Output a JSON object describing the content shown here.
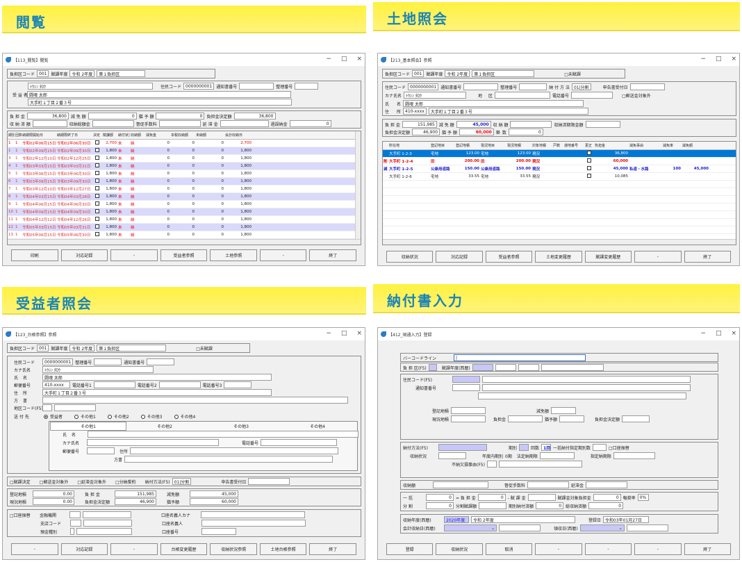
{
  "p1": {
    "banner": "閲覧",
    "title": "【113_閲覧】閲覧",
    "h1": [
      "負担区コード",
      "001",
      "賦課年度",
      "令和 2年度",
      "第１負担区"
    ],
    "jc": "住民コード",
    "jcv": "0000000001",
    "tsu": "通知書番号",
    "sei": "整理番号",
    "kana": "ﾄｳｼﾝ ﾀﾛｳ",
    "jusha": "受 益 者",
    "name": "闘魂 太郎",
    "addr": "大手町１丁目２番３号",
    "r3": [
      "負 担 金",
      "36,800",
      "減 免 額",
      "0",
      "猶 予 額",
      "0",
      "負担金決定額",
      "36,800"
    ],
    "r4": [
      "収 納 済 額",
      "収納総額金",
      "督促手数料",
      "延 滞 金",
      "過誤納金",
      "0"
    ],
    "cols": [
      "期別",
      "回数",
      "納期限開始日",
      "納期限終了日",
      "決定",
      "賦課額",
      "納付状況",
      "収納額",
      "減免金",
      "本税収納額",
      "未納額",
      "会計収納日"
    ],
    "rows": [
      [
        "1",
        "1",
        "令和02年06月15日",
        "令和02年06月30日",
        "2,700",
        "未",
        "納",
        "0",
        "0",
        "0",
        "2,700"
      ],
      [
        "1",
        "1",
        "令和02年09月15日",
        "令和02年09月30日",
        "1,800",
        "未",
        "納",
        "0",
        "0",
        "0",
        "1,800"
      ],
      [
        "3",
        "1",
        "令和02年12月10日",
        "令和02年12月25日",
        "1,800",
        "未",
        "納",
        "0",
        "0",
        "0",
        "1,800"
      ],
      [
        "4",
        "1",
        "令和03年03月15日",
        "令和03年03月31日",
        "1,800",
        "未",
        "納",
        "0",
        "0",
        "0",
        "1,800"
      ],
      [
        "5",
        "1",
        "令和03年06月15日",
        "令和03年06月30日",
        "1,800",
        "未",
        "納",
        "0",
        "0",
        "0",
        "1,800"
      ],
      [
        "6",
        "1",
        "令和03年09月15日",
        "令和03年09月30日",
        "1,800",
        "未",
        "納",
        "0",
        "0",
        "0",
        "1,800"
      ],
      [
        "7",
        "1",
        "令和03年12月10日",
        "令和03年12月27日",
        "1,800",
        "未",
        "納",
        "0",
        "0",
        "0",
        "1,800"
      ],
      [
        "8",
        "1",
        "令和04年03月15日",
        "令和04年03月28日",
        "1,800",
        "未",
        "納",
        "0",
        "0",
        "0",
        "1,800"
      ],
      [
        "9",
        "1",
        "令和04年06月15日",
        "令和04年06月30日",
        "1,800",
        "未",
        "納",
        "0",
        "0",
        "0",
        "1,800"
      ],
      [
        "10",
        "1",
        "令和04年09月15日",
        "令和04年09月30日",
        "1,800",
        "未",
        "納",
        "0",
        "0",
        "0",
        "1,800"
      ],
      [
        "11",
        "1",
        "令和04年12月12日",
        "令和04年12月26日",
        "1,800",
        "未",
        "納",
        "0",
        "0",
        "0",
        "1,800"
      ],
      [
        "12",
        "1",
        "令和05年03月15日",
        "令和05年03月31日",
        "1,800",
        "未",
        "納",
        "0",
        "0",
        "0",
        "1,800"
      ],
      [
        "13",
        "1",
        "令和05年06月15日",
        "令和05年06月30日",
        "1,800",
        "未",
        "納",
        "0",
        "0",
        "0",
        "1,800"
      ]
    ],
    "btns": [
      "印刷",
      "対応記録",
      "-",
      "受益者参照",
      "土地参照",
      "-",
      "終了"
    ]
  },
  "p2": {
    "banner": "土地照会",
    "title": "【213_基本照会】参照",
    "h1": [
      "負担区コード",
      "001",
      "賦課年度",
      "令和 2年度",
      "第１負担区",
      "□未賦課"
    ],
    "r2": [
      "住民コード",
      "0000000001",
      "通知書番号",
      "整理番号",
      "納 付 方 法",
      "01|分割",
      "申告書受付日"
    ],
    "r3": [
      "カナ氏名",
      "ﾄｳｼﾝ ﾀﾛｳ",
      "地",
      "区",
      "電話番号",
      "□郵送金対象外"
    ],
    "r4": [
      "氏",
      "名",
      "闘魂 太郎"
    ],
    "r5": [
      "住",
      "所",
      "410-xxxx",
      "大手町１丁目２番３号"
    ],
    "s1": [
      "負 担 金",
      "151,985",
      "減 免 額",
      "45,000",
      "収 納 額",
      "収納済期限金額"
    ],
    "s2": [
      "負担金決定額",
      "46,900",
      "猶 予 額",
      "60,000",
      "築",
      "数",
      "0"
    ],
    "cols": [
      "所在地",
      "登記地目",
      "登記地積",
      "現況地目",
      "現況地積",
      "対象地積",
      "戸数",
      "通地番号",
      "更正",
      "負担金",
      "減免事由",
      "減免率",
      "減免額"
    ],
    "rows": [
      [
        "大手町 1-2-3",
        "宅地",
        "123.00",
        "宅地",
        "123.00",
        "現況",
        "36,800",
        "",
        "",
        ""
      ],
      [
        "大手町 1-2-4",
        "田",
        "200.00",
        "田",
        "200.00",
        "現況",
        "60,000",
        "",
        "",
        ""
      ],
      [
        "大手町 1-2-5",
        "公衆用道路",
        "150.00",
        "公衆用道路",
        "150.00",
        "現況",
        "45,000",
        "私道・水路",
        "100",
        "45,000"
      ],
      [
        "大手町 1-2-6",
        "宅地",
        "33.55",
        "宅地",
        "33.55",
        "現況",
        "10,085",
        "",
        "",
        ""
      ]
    ],
    "flags": [
      "",
      "削",
      "減",
      ""
    ],
    "btns": [
      "収納状況",
      "対応記録",
      "受益者参照",
      "土地変更履歴",
      "賦課変更履歴",
      "-",
      "終了"
    ]
  },
  "p3": {
    "banner": "受益者照会",
    "title": "【123_台帳参照】参照",
    "h1": [
      "負担区コード",
      "001",
      "賦課年度",
      "令和 2年度",
      "第１負担区",
      "□未賦課"
    ],
    "f": [
      "住民コード",
      "0000000001",
      "整理番号",
      "通知書番号",
      "カナ氏名",
      "ﾄｳｼﾝ ﾀﾛｳ",
      "氏",
      "名",
      "闘魂 太郎",
      "郵便番号",
      "410-xxxx",
      "電話番号1",
      "電話番号2",
      "電話番号3",
      "住",
      "所",
      "大手町１丁目２番３号",
      "方",
      "書",
      "地区コード(F5)"
    ],
    "send": [
      "送 付 先",
      "受益者",
      "その他1",
      "その他2",
      "その他3",
      "その他4"
    ],
    "tabs": [
      "その他1",
      "その他2",
      "その他3",
      "その他4"
    ],
    "sub": [
      "氏",
      "名",
      "カナ氏名",
      "電話番号",
      "郵便番号",
      "住所",
      "方書"
    ],
    "chk": [
      "□賦課決定",
      "□郵送金対象外",
      "□延滞金対象外",
      "□分納誓約",
      "納付方法(F5)",
      "01|分割",
      "申告書受付日"
    ],
    "m1": [
      "登記地積",
      "0.00",
      "負 担 金",
      "151,985",
      "減免額",
      "45,000"
    ],
    "m2": [
      "現況地積",
      "0.00",
      "負担金決定額",
      "46,900",
      "猶予額",
      "60,000"
    ],
    "bank": [
      "□口座振替",
      "金融機関",
      "支店コード",
      "預金種別",
      "口座名義人カナ",
      "口座名義人",
      "口座番号"
    ],
    "btns": [
      "-",
      "対応記録",
      "-",
      "台帳変更履歴",
      "収納状況参照",
      "土地台帳参照",
      "終了"
    ]
  },
  "p4": {
    "banner": "納付書入力",
    "title": "【412_現通入力】登録",
    "bc": "バーコードライン",
    "h": [
      "負 担 区(F5)",
      "賦課年度(西暦)"
    ],
    "g2": [
      "住民コード(F5)",
      "通知書番号",
      "登記地積",
      "減免額",
      "現況地積",
      "負担金",
      "猶予額",
      "負担金決定額"
    ],
    "g3": [
      "納付方法(F5)",
      "期別",
      "回数",
      "1回",
      "一括納付指定期別数",
      "□口座振替",
      "収納状況",
      "年度内期別",
      "0期",
      "法定納期限",
      "指定納期限",
      "不納欠損事由(F5)"
    ],
    "g4": [
      "収納額",
      "督促手数料",
      "延滞金"
    ],
    "g5": [
      "一 括",
      "0",
      "= 負 担 金",
      "0",
      "- 賦 課 金",
      "賦課金対象負担金",
      "0",
      "報奨率",
      "0%",
      "分 割",
      "0",
      "分割賦課額",
      "期別納付済額",
      "0",
      "総収納済額",
      "0"
    ],
    "g6": [
      "収納年度(西暦)",
      "2020年度",
      "令和 2年度",
      "登録日",
      "令和03年01月27日",
      "会計収納日(西暦)",
      "領収日(西暦)"
    ],
    "btns": [
      "登録",
      "収納状況",
      "取消",
      "-",
      "-",
      "-",
      "終了"
    ]
  }
}
